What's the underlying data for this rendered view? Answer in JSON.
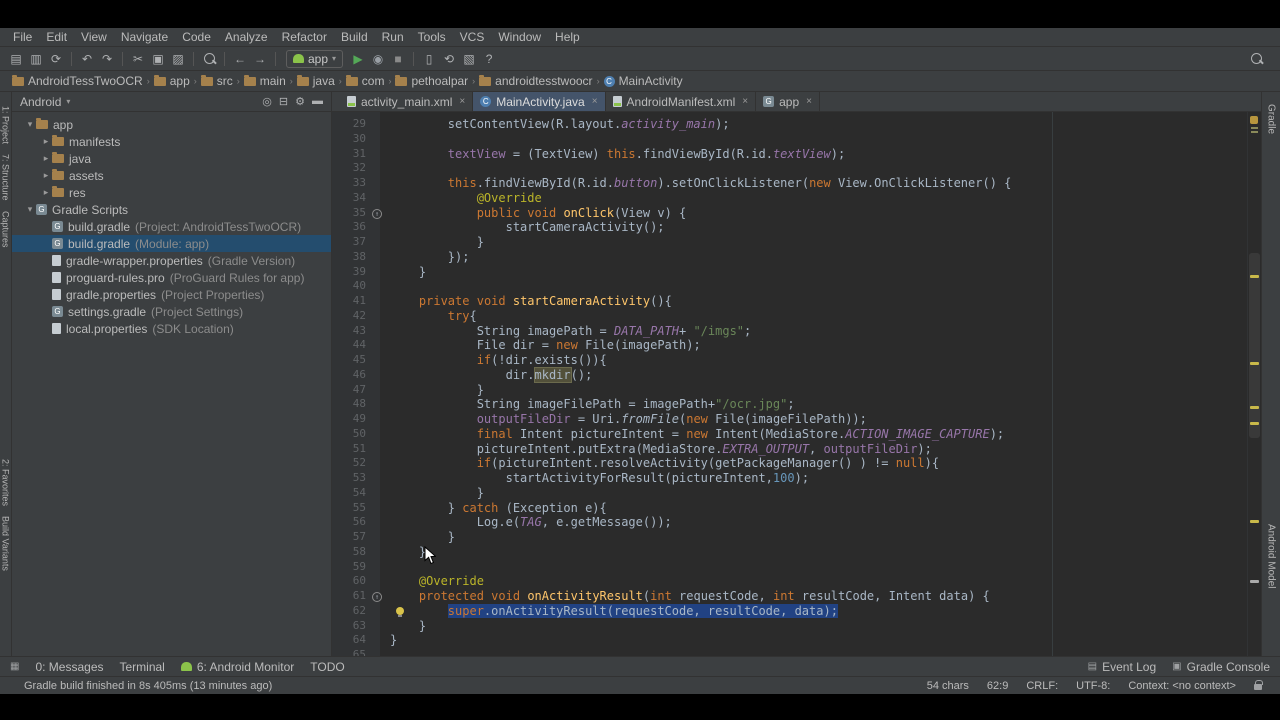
{
  "colors": {
    "editor_bg": "#2b2b2b",
    "panel_bg": "#3c3f41",
    "selection": "#214283",
    "tree_selection": "#244d6e",
    "keyword": "#cc7832",
    "string": "#6a8759",
    "accent_green": "#8bc34a"
  },
  "menu": {
    "items": [
      "File",
      "Edit",
      "View",
      "Navigate",
      "Code",
      "Analyze",
      "Refactor",
      "Build",
      "Run",
      "Tools",
      "VCS",
      "Window",
      "Help"
    ]
  },
  "toolbar": {
    "items": [
      {
        "t": "i",
        "name": "open-project-icon",
        "glyph": "▤"
      },
      {
        "t": "i",
        "name": "save-all-icon",
        "glyph": "▥"
      },
      {
        "t": "i",
        "name": "sync-files-icon",
        "glyph": "⟳"
      },
      {
        "t": "sep"
      },
      {
        "t": "i",
        "name": "undo-icon",
        "glyph": "↶"
      },
      {
        "t": "i",
        "name": "redo-icon",
        "glyph": "↷"
      },
      {
        "t": "sep"
      },
      {
        "t": "i",
        "name": "cut-icon",
        "glyph": "✂"
      },
      {
        "t": "i",
        "name": "copy-icon",
        "glyph": "▣"
      },
      {
        "t": "i",
        "name": "paste-icon",
        "glyph": "▨"
      },
      {
        "t": "sep"
      },
      {
        "t": "i",
        "name": "find-icon",
        "css": "search"
      },
      {
        "t": "sep"
      },
      {
        "t": "i",
        "name": "back-icon",
        "glyph": "←"
      },
      {
        "t": "i",
        "name": "forward-icon",
        "glyph": "→"
      },
      {
        "t": "sep"
      },
      {
        "t": "run",
        "label": "app"
      },
      {
        "t": "i",
        "name": "run-button",
        "glyph": "▶",
        "color": "#54a857"
      },
      {
        "t": "i",
        "name": "debug-button",
        "glyph": "◉",
        "color": "#9aa0a6"
      },
      {
        "t": "i",
        "name": "stop-button",
        "glyph": "■",
        "color": "#8a8a8a"
      },
      {
        "t": "sep"
      },
      {
        "t": "i",
        "name": "avd-manager-icon",
        "glyph": "▯"
      },
      {
        "t": "i",
        "name": "sync-gradle-icon",
        "glyph": "⟲"
      },
      {
        "t": "i",
        "name": "sdk-manager-icon",
        "glyph": "▧"
      },
      {
        "t": "i",
        "name": "help-icon",
        "glyph": "?"
      }
    ],
    "right_items": [
      {
        "name": "search-everywhere-icon",
        "css": "search"
      }
    ]
  },
  "breadcrumbs": {
    "items": [
      {
        "label": "AndroidTessTwoOCR",
        "icon": "folder"
      },
      {
        "label": "app",
        "icon": "folder"
      },
      {
        "label": "src",
        "icon": "folder"
      },
      {
        "label": "main",
        "icon": "folder"
      },
      {
        "label": "java",
        "icon": "folder"
      },
      {
        "label": "com",
        "icon": "folder"
      },
      {
        "label": "pethoalpar",
        "icon": "folder"
      },
      {
        "label": "androidtesstwoocr",
        "icon": "folder"
      },
      {
        "label": "MainActivity",
        "icon": "class"
      }
    ]
  },
  "project": {
    "view_selector": "Android",
    "header_icons": [
      {
        "name": "locate-file-icon",
        "glyph": "◎"
      },
      {
        "name": "collapse-all-icon",
        "glyph": "⊟"
      },
      {
        "name": "settings-gear-icon",
        "glyph": "⚙"
      },
      {
        "name": "hide-panel-icon",
        "glyph": "▬"
      }
    ],
    "tree": [
      {
        "label": "app",
        "type": "folder",
        "level": 0,
        "arrow": "▾"
      },
      {
        "label": "manifests",
        "type": "folder",
        "level": 1,
        "arrow": "▸"
      },
      {
        "label": "java",
        "type": "folder",
        "level": 1,
        "arrow": "▸"
      },
      {
        "label": "assets",
        "type": "folder",
        "level": 1,
        "arrow": "▸"
      },
      {
        "label": "res",
        "type": "folder",
        "level": 1,
        "arrow": "▸"
      },
      {
        "label": "Gradle Scripts",
        "type": "gradle",
        "level": 0,
        "arrow": "▾"
      },
      {
        "label": "build.gradle",
        "hint": "(Project: AndroidTessTwoOCR)",
        "type": "gradle",
        "level": 1
      },
      {
        "label": "build.gradle",
        "hint": "(Module: app)",
        "type": "gradle",
        "level": 1,
        "selected": true
      },
      {
        "label": "gradle-wrapper.properties",
        "hint": "(Gradle Version)",
        "type": "file",
        "level": 1
      },
      {
        "label": "proguard-rules.pro",
        "hint": "(ProGuard Rules for app)",
        "type": "file",
        "level": 1
      },
      {
        "label": "gradle.properties",
        "hint": "(Project Properties)",
        "type": "file",
        "level": 1
      },
      {
        "label": "settings.gradle",
        "hint": "(Project Settings)",
        "type": "gradle",
        "level": 1
      },
      {
        "label": "local.properties",
        "hint": "(SDK Location)",
        "type": "file",
        "level": 1
      }
    ]
  },
  "tabs": [
    {
      "label": "activity_main.xml",
      "icon": "xml",
      "active": false
    },
    {
      "label": "MainActivity.java",
      "icon": "class",
      "active": true
    },
    {
      "label": "AndroidManifest.xml",
      "icon": "xml",
      "active": false
    },
    {
      "label": "app",
      "icon": "gradle",
      "active": false
    }
  ],
  "editor": {
    "icons": {
      "override": "↑"
    },
    "stripe_marks": [
      {
        "top": "30%",
        "color": "#c9b94a"
      },
      {
        "top": "46%",
        "color": "#c9b94a"
      },
      {
        "top": "54%",
        "color": "#c9b94a"
      },
      {
        "top": "57%",
        "color": "#c9b94a"
      },
      {
        "top": "75%",
        "color": "#c9b94a"
      },
      {
        "top": "86%",
        "color": "#aaaaaa"
      }
    ],
    "lines": [
      {
        "n": 29,
        "tokens": [
          [
            "        setContentView(R.layout.",
            "p"
          ],
          [
            "activity_main",
            "sf"
          ],
          [
            ");",
            "p"
          ]
        ]
      },
      {
        "n": 30,
        "tokens": []
      },
      {
        "n": 31,
        "tokens": [
          [
            "        ",
            "p"
          ],
          [
            "textView",
            "f"
          ],
          [
            " = (TextView) ",
            "p"
          ],
          [
            "this",
            "k"
          ],
          [
            ".findViewById(R.id.",
            "p"
          ],
          [
            "textView",
            "sf"
          ],
          [
            ");",
            "p"
          ]
        ]
      },
      {
        "n": 32,
        "tokens": []
      },
      {
        "n": 33,
        "tokens": [
          [
            "        ",
            "p"
          ],
          [
            "this",
            "k"
          ],
          [
            ".findViewById(R.id.",
            "p"
          ],
          [
            "button",
            "sf"
          ],
          [
            ").setOnClickListener(",
            "p"
          ],
          [
            "new",
            "k"
          ],
          [
            " View.OnClickListener() {",
            "p"
          ]
        ]
      },
      {
        "n": 34,
        "tokens": [
          [
            "            ",
            "p"
          ],
          [
            "@Override",
            "an"
          ]
        ]
      },
      {
        "n": 35,
        "gutter": "override",
        "tokens": [
          [
            "            ",
            "p"
          ],
          [
            "public",
            "k"
          ],
          [
            " ",
            "p"
          ],
          [
            "void",
            "k"
          ],
          [
            " ",
            "p"
          ],
          [
            "onClick",
            "m"
          ],
          [
            "(View v) {",
            "p"
          ]
        ]
      },
      {
        "n": 36,
        "tokens": [
          [
            "                startCameraActivity();",
            "p"
          ]
        ]
      },
      {
        "n": 37,
        "tokens": [
          [
            "            }",
            "p"
          ]
        ]
      },
      {
        "n": 38,
        "tokens": [
          [
            "        });",
            "p"
          ]
        ]
      },
      {
        "n": 39,
        "tokens": [
          [
            "    }",
            "p"
          ]
        ]
      },
      {
        "n": 40,
        "tokens": []
      },
      {
        "n": 41,
        "tokens": [
          [
            "    ",
            "p"
          ],
          [
            "private",
            "k"
          ],
          [
            " ",
            "p"
          ],
          [
            "void",
            "k"
          ],
          [
            " ",
            "p"
          ],
          [
            "startCameraActivity",
            "m"
          ],
          [
            "(){",
            "p"
          ]
        ]
      },
      {
        "n": 42,
        "tokens": [
          [
            "        ",
            "p"
          ],
          [
            "try",
            "k"
          ],
          [
            "{",
            "p"
          ]
        ]
      },
      {
        "n": 43,
        "tokens": [
          [
            "            String imagePath = ",
            "p"
          ],
          [
            "DATA_PATH",
            "sf"
          ],
          [
            "+ ",
            "p"
          ],
          [
            "\"/imgs\"",
            "s"
          ],
          [
            ";",
            "p"
          ]
        ]
      },
      {
        "n": 44,
        "tokens": [
          [
            "            File dir = ",
            "p"
          ],
          [
            "new",
            "k"
          ],
          [
            " File(imagePath);",
            "p"
          ]
        ]
      },
      {
        "n": 45,
        "tokens": [
          [
            "            ",
            "p"
          ],
          [
            "if",
            "k"
          ],
          [
            "(!dir.exists()){",
            "p"
          ]
        ]
      },
      {
        "n": 46,
        "tokens": [
          [
            "                dir.",
            "p"
          ],
          [
            "mkdir",
            "w"
          ],
          [
            "();",
            "p"
          ]
        ]
      },
      {
        "n": 47,
        "tokens": [
          [
            "            }",
            "p"
          ]
        ]
      },
      {
        "n": 48,
        "tokens": [
          [
            "            String imageFilePath = imagePath+",
            "p"
          ],
          [
            "\"/ocr.jpg\"",
            "s"
          ],
          [
            ";",
            "p"
          ]
        ]
      },
      {
        "n": 49,
        "tokens": [
          [
            "            ",
            "p"
          ],
          [
            "outputFileDir",
            "f"
          ],
          [
            " = Uri.",
            "p"
          ],
          [
            "fromFile",
            "si"
          ],
          [
            "(",
            "p"
          ],
          [
            "new",
            "k"
          ],
          [
            " File(imageFilePath));",
            "p"
          ]
        ]
      },
      {
        "n": 50,
        "tokens": [
          [
            "            ",
            "p"
          ],
          [
            "final",
            "k"
          ],
          [
            " Intent pictureIntent = ",
            "p"
          ],
          [
            "new",
            "k"
          ],
          [
            " Intent(MediaStore.",
            "p"
          ],
          [
            "ACTION_IMAGE_CAPTURE",
            "sf"
          ],
          [
            ");",
            "p"
          ]
        ]
      },
      {
        "n": 51,
        "tokens": [
          [
            "            pictureIntent.putExtra(MediaStore.",
            "p"
          ],
          [
            "EXTRA_OUTPUT",
            "sf"
          ],
          [
            ", ",
            "p"
          ],
          [
            "outputFileDir",
            "f"
          ],
          [
            ");",
            "p"
          ]
        ]
      },
      {
        "n": 52,
        "tokens": [
          [
            "            ",
            "p"
          ],
          [
            "if",
            "k"
          ],
          [
            "(pictureIntent.resolveActivity(getPackageManager() ) != ",
            "p"
          ],
          [
            "null",
            "k"
          ],
          [
            "){",
            "p"
          ]
        ]
      },
      {
        "n": 53,
        "tokens": [
          [
            "                startActivityForResult(pictureIntent,",
            "p"
          ],
          [
            "100",
            "n"
          ],
          [
            ");",
            "p"
          ]
        ]
      },
      {
        "n": 54,
        "tokens": [
          [
            "            }",
            "p"
          ]
        ]
      },
      {
        "n": 55,
        "tokens": [
          [
            "        } ",
            "p"
          ],
          [
            "catch",
            "k"
          ],
          [
            " (Exception e){",
            "p"
          ]
        ]
      },
      {
        "n": 56,
        "tokens": [
          [
            "            Log.e(",
            "p"
          ],
          [
            "TAG",
            "sf"
          ],
          [
            ", e.getMessage());",
            "p"
          ]
        ]
      },
      {
        "n": 57,
        "tokens": [
          [
            "        }",
            "p"
          ]
        ]
      },
      {
        "n": 58,
        "tokens": [
          [
            "    }",
            "p"
          ]
        ]
      },
      {
        "n": 59,
        "tokens": []
      },
      {
        "n": 60,
        "tokens": [
          [
            "    ",
            "p"
          ],
          [
            "@Override",
            "an"
          ]
        ]
      },
      {
        "n": 61,
        "gutter": "override",
        "tokens": [
          [
            "    ",
            "p"
          ],
          [
            "protected",
            "k"
          ],
          [
            " ",
            "p"
          ],
          [
            "void",
            "k"
          ],
          [
            " ",
            "p"
          ],
          [
            "onActivityResult",
            "m"
          ],
          [
            "(",
            "p"
          ],
          [
            "int",
            "k"
          ],
          [
            " requestCode, ",
            "p"
          ],
          [
            "int",
            "k"
          ],
          [
            " resultCode, Intent data) {",
            "p"
          ]
        ]
      },
      {
        "n": 62,
        "sel": true,
        "bulb": true,
        "tokens": [
          [
            "        ",
            "p"
          ],
          [
            "super",
            "k"
          ],
          [
            ".onActivityResult(requestCode, resultCode, data);",
            "p"
          ]
        ]
      },
      {
        "n": 63,
        "tokens": [
          [
            "    }",
            "p"
          ]
        ]
      },
      {
        "n": 64,
        "tokens": [
          [
            "}",
            "p"
          ]
        ]
      },
      {
        "n": 65,
        "tokens": []
      }
    ]
  },
  "tool_strips": {
    "left": [
      "1: Project",
      "7: Structure",
      "Captures",
      "2: Favorites",
      "Build Variants"
    ],
    "right": [
      "Gradle",
      "Android Model"
    ]
  },
  "bottom_tools": {
    "left": [
      {
        "name": "toolwindow-switcher-icon",
        "glyph": "▦",
        "label": ""
      },
      {
        "name": "messages",
        "label": "0: Messages"
      },
      {
        "name": "terminal",
        "label": "Terminal"
      },
      {
        "name": "android-monitor",
        "label": "6: Android Monitor",
        "icon": "android"
      },
      {
        "name": "todo",
        "label": "TODO"
      }
    ],
    "right": [
      {
        "name": "event-log",
        "glyph": "▤",
        "label": "Event Log"
      },
      {
        "name": "gradle-console",
        "glyph": "▣",
        "label": "Gradle Console"
      }
    ]
  },
  "status": {
    "left": "Gradle build finished in 8s 405ms (13 minutes ago)",
    "right": [
      "54 chars",
      "62:9",
      "CRLF:",
      "UTF-8:",
      "Context: <no context>"
    ]
  }
}
